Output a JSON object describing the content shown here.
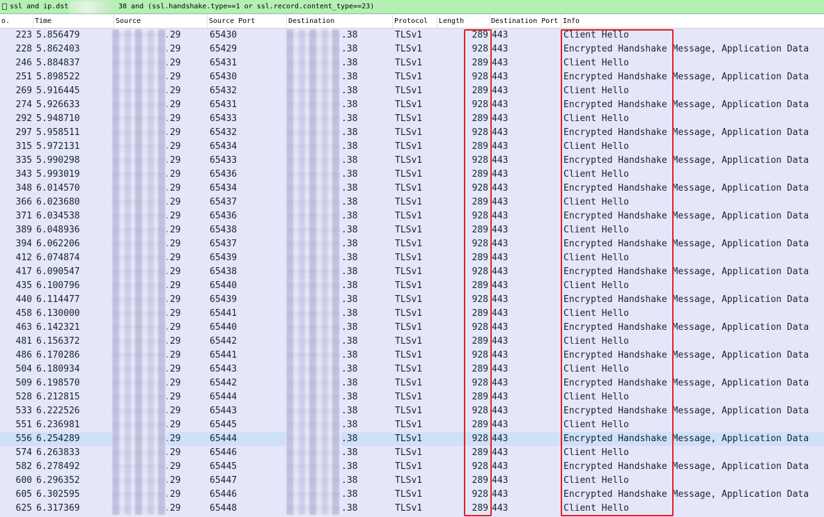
{
  "filter": {
    "left_text": "ssl and ip.dst",
    "right_text": "38 and (ssl.handshake.type==1 or ssl.record.content_type==23)"
  },
  "columns": {
    "no": "o.",
    "time": "Time",
    "source": "Source",
    "source_port": "Source Port",
    "destination": "Destination",
    "protocol": "Protocol",
    "length": "Length",
    "destination_port": "Destination Port",
    "info": "Info"
  },
  "rows": [
    {
      "no": "223",
      "time": "5.856479",
      "src": ".29",
      "sport": "65430",
      "dst": ".38",
      "proto": "TLSv1",
      "len": "289",
      "dport": "443",
      "info": "Client Hello"
    },
    {
      "no": "228",
      "time": "5.862403",
      "src": ".29",
      "sport": "65429",
      "dst": ".38",
      "proto": "TLSv1",
      "len": "928",
      "dport": "443",
      "info": "Encrypted Handshake Message, Application Data"
    },
    {
      "no": "246",
      "time": "5.884837",
      "src": ".29",
      "sport": "65431",
      "dst": ".38",
      "proto": "TLSv1",
      "len": "289",
      "dport": "443",
      "info": "Client Hello"
    },
    {
      "no": "251",
      "time": "5.898522",
      "src": ".29",
      "sport": "65430",
      "dst": ".38",
      "proto": "TLSv1",
      "len": "928",
      "dport": "443",
      "info": "Encrypted Handshake Message, Application Data"
    },
    {
      "no": "269",
      "time": "5.916445",
      "src": ".29",
      "sport": "65432",
      "dst": ".38",
      "proto": "TLSv1",
      "len": "289",
      "dport": "443",
      "info": "Client Hello"
    },
    {
      "no": "274",
      "time": "5.926633",
      "src": ".29",
      "sport": "65431",
      "dst": ".38",
      "proto": "TLSv1",
      "len": "928",
      "dport": "443",
      "info": "Encrypted Handshake Message, Application Data"
    },
    {
      "no": "292",
      "time": "5.948710",
      "src": ".29",
      "sport": "65433",
      "dst": ".38",
      "proto": "TLSv1",
      "len": "289",
      "dport": "443",
      "info": "Client Hello"
    },
    {
      "no": "297",
      "time": "5.958511",
      "src": ".29",
      "sport": "65432",
      "dst": ".38",
      "proto": "TLSv1",
      "len": "928",
      "dport": "443",
      "info": "Encrypted Handshake Message, Application Data"
    },
    {
      "no": "315",
      "time": "5.972131",
      "src": ".29",
      "sport": "65434",
      "dst": ".38",
      "proto": "TLSv1",
      "len": "289",
      "dport": "443",
      "info": "Client Hello"
    },
    {
      "no": "335",
      "time": "5.990298",
      "src": ".29",
      "sport": "65433",
      "dst": ".38",
      "proto": "TLSv1",
      "len": "928",
      "dport": "443",
      "info": "Encrypted Handshake Message, Application Data"
    },
    {
      "no": "343",
      "time": "5.993019",
      "src": ".29",
      "sport": "65436",
      "dst": ".38",
      "proto": "TLSv1",
      "len": "289",
      "dport": "443",
      "info": "Client Hello"
    },
    {
      "no": "348",
      "time": "6.014570",
      "src": ".29",
      "sport": "65434",
      "dst": ".38",
      "proto": "TLSv1",
      "len": "928",
      "dport": "443",
      "info": "Encrypted Handshake Message, Application Data"
    },
    {
      "no": "366",
      "time": "6.023680",
      "src": ".29",
      "sport": "65437",
      "dst": ".38",
      "proto": "TLSv1",
      "len": "289",
      "dport": "443",
      "info": "Client Hello"
    },
    {
      "no": "371",
      "time": "6.034538",
      "src": ".29",
      "sport": "65436",
      "dst": ".38",
      "proto": "TLSv1",
      "len": "928",
      "dport": "443",
      "info": "Encrypted Handshake Message, Application Data"
    },
    {
      "no": "389",
      "time": "6.048936",
      "src": ".29",
      "sport": "65438",
      "dst": ".38",
      "proto": "TLSv1",
      "len": "289",
      "dport": "443",
      "info": "Client Hello"
    },
    {
      "no": "394",
      "time": "6.062206",
      "src": ".29",
      "sport": "65437",
      "dst": ".38",
      "proto": "TLSv1",
      "len": "928",
      "dport": "443",
      "info": "Encrypted Handshake Message, Application Data"
    },
    {
      "no": "412",
      "time": "6.074874",
      "src": ".29",
      "sport": "65439",
      "dst": ".38",
      "proto": "TLSv1",
      "len": "289",
      "dport": "443",
      "info": "Client Hello"
    },
    {
      "no": "417",
      "time": "6.090547",
      "src": ".29",
      "sport": "65438",
      "dst": ".38",
      "proto": "TLSv1",
      "len": "928",
      "dport": "443",
      "info": "Encrypted Handshake Message, Application Data"
    },
    {
      "no": "435",
      "time": "6.100796",
      "src": ".29",
      "sport": "65440",
      "dst": ".38",
      "proto": "TLSv1",
      "len": "289",
      "dport": "443",
      "info": "Client Hello"
    },
    {
      "no": "440",
      "time": "6.114477",
      "src": ".29",
      "sport": "65439",
      "dst": ".38",
      "proto": "TLSv1",
      "len": "928",
      "dport": "443",
      "info": "Encrypted Handshake Message, Application Data"
    },
    {
      "no": "458",
      "time": "6.130000",
      "src": ".29",
      "sport": "65441",
      "dst": ".38",
      "proto": "TLSv1",
      "len": "289",
      "dport": "443",
      "info": "Client Hello"
    },
    {
      "no": "463",
      "time": "6.142321",
      "src": ".29",
      "sport": "65440",
      "dst": ".38",
      "proto": "TLSv1",
      "len": "928",
      "dport": "443",
      "info": "Encrypted Handshake Message, Application Data"
    },
    {
      "no": "481",
      "time": "6.156372",
      "src": ".29",
      "sport": "65442",
      "dst": ".38",
      "proto": "TLSv1",
      "len": "289",
      "dport": "443",
      "info": "Client Hello"
    },
    {
      "no": "486",
      "time": "6.170286",
      "src": ".29",
      "sport": "65441",
      "dst": ".38",
      "proto": "TLSv1",
      "len": "928",
      "dport": "443",
      "info": "Encrypted Handshake Message, Application Data"
    },
    {
      "no": "504",
      "time": "6.180934",
      "src": ".29",
      "sport": "65443",
      "dst": ".38",
      "proto": "TLSv1",
      "len": "289",
      "dport": "443",
      "info": "Client Hello"
    },
    {
      "no": "509",
      "time": "6.198570",
      "src": ".29",
      "sport": "65442",
      "dst": ".38",
      "proto": "TLSv1",
      "len": "928",
      "dport": "443",
      "info": "Encrypted Handshake Message, Application Data"
    },
    {
      "no": "528",
      "time": "6.212815",
      "src": ".29",
      "sport": "65444",
      "dst": ".38",
      "proto": "TLSv1",
      "len": "289",
      "dport": "443",
      "info": "Client Hello"
    },
    {
      "no": "533",
      "time": "6.222526",
      "src": ".29",
      "sport": "65443",
      "dst": ".38",
      "proto": "TLSv1",
      "len": "928",
      "dport": "443",
      "info": "Encrypted Handshake Message, Application Data"
    },
    {
      "no": "551",
      "time": "6.236981",
      "src": ".29",
      "sport": "65445",
      "dst": ".38",
      "proto": "TLSv1",
      "len": "289",
      "dport": "443",
      "info": "Client Hello"
    },
    {
      "no": "556",
      "time": "6.254289",
      "src": ".29",
      "sport": "65444",
      "dst": ".38",
      "proto": "TLSv1",
      "len": "928",
      "dport": "443",
      "info": "Encrypted Handshake Message, Application Data",
      "selected": true
    },
    {
      "no": "574",
      "time": "6.263833",
      "src": ".29",
      "sport": "65446",
      "dst": ".38",
      "proto": "TLSv1",
      "len": "289",
      "dport": "443",
      "info": "Client Hello"
    },
    {
      "no": "582",
      "time": "6.278492",
      "src": ".29",
      "sport": "65445",
      "dst": ".38",
      "proto": "TLSv1",
      "len": "928",
      "dport": "443",
      "info": "Encrypted Handshake Message, Application Data"
    },
    {
      "no": "600",
      "time": "6.296352",
      "src": ".29",
      "sport": "65447",
      "dst": ".38",
      "proto": "TLSv1",
      "len": "289",
      "dport": "443",
      "info": "Client Hello"
    },
    {
      "no": "605",
      "time": "6.302595",
      "src": ".29",
      "sport": "65446",
      "dst": ".38",
      "proto": "TLSv1",
      "len": "928",
      "dport": "443",
      "info": "Encrypted Handshake Message, Application Data"
    },
    {
      "no": "625",
      "time": "6.317369",
      "src": ".29",
      "sport": "65448",
      "dst": ".38",
      "proto": "TLSv1",
      "len": "289",
      "dport": "443",
      "info": "Client Hello"
    }
  ],
  "colors": {
    "row_background": "#e6e6fa",
    "selected_row": "#cfe0f9",
    "filter_bar": "#b4f0b4",
    "highlight_box": "#e02020"
  }
}
